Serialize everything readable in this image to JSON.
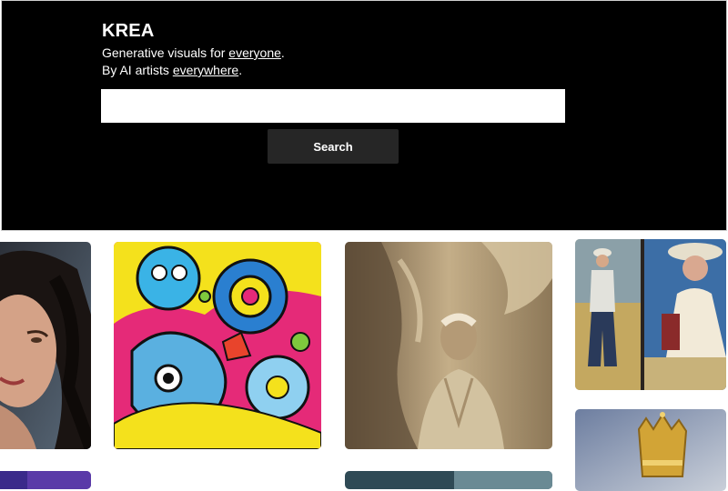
{
  "header": {
    "brand": "KREA",
    "line1_prefix": "Generative visuals for ",
    "line1_link": "everyone",
    "line1_suffix": ".",
    "line2_prefix": "By AI artists ",
    "line2_link": "everywhere",
    "line2_suffix": "."
  },
  "search": {
    "value": "",
    "placeholder": "",
    "button_label": "Search"
  },
  "gallery": {
    "tiles": [
      {
        "subject": "portrait of a woman with dark wavy hair",
        "colors": [
          "#3a3f4a",
          "#c8967a"
        ]
      },
      {
        "subject": "psychedelic cartoon creatures in space",
        "colors": [
          "#e5267b",
          "#2bb3e8",
          "#f6e21a"
        ]
      },
      {
        "subject": "sculpted old man in beige relief",
        "colors": [
          "#8a7458",
          "#d9c9a8"
        ]
      },
      {
        "subject": "painting of a man in a field and a woman with a hat",
        "colors": [
          "#b9b48f",
          "#2f4f7a"
        ]
      },
      {
        "subject": "golden crown",
        "colors": [
          "#4a5a7a",
          "#d6a93a"
        ]
      },
      {
        "subject": "partially visible thumbnail",
        "colors": [
          "#3a2a8a"
        ]
      },
      {
        "subject": "partially visible thumbnail",
        "colors": [
          "#2f4a55"
        ]
      }
    ]
  }
}
